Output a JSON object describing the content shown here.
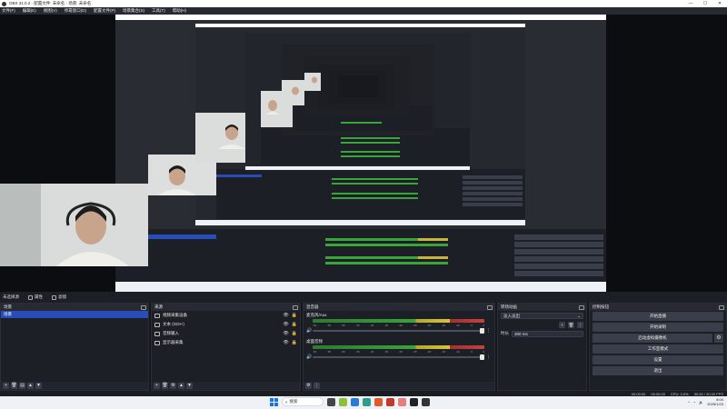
{
  "window": {
    "title": "OBS 31.0.2 - 配置文件: 未命名 - 场景: 未命名",
    "controls": [
      "—",
      "☐",
      "✕"
    ]
  },
  "menubar": [
    "文件(F)",
    "编辑(E)",
    "视图(V)",
    "停靠窗口(D)",
    "配置文件(P)",
    "场景集合(S)",
    "工具(T)",
    "帮助(H)"
  ],
  "sceneinfo": {
    "label": "未选择源",
    "props_btn": "属性",
    "filters_btn": "滤镜"
  },
  "docks": {
    "scenes": {
      "title": "场景",
      "items": [
        {
          "label": "场景",
          "selected": true
        }
      ]
    },
    "sources": {
      "title": "来源",
      "items": [
        {
          "name": "视频采集设备",
          "icon": "camera-icon"
        },
        {
          "name": "文本 (GDI+)",
          "icon": "text-icon"
        },
        {
          "name": "音频输入",
          "icon": "mic-icon"
        },
        {
          "name": "显示器采集",
          "icon": "monitor-icon"
        }
      ]
    },
    "mixer": {
      "title": "混音器",
      "scale": [
        "-60",
        "-55",
        "-50",
        "-45",
        "-40",
        "-35",
        "-30",
        "-25",
        "-20",
        "-15",
        "-10",
        "-5",
        "0"
      ],
      "tracks": [
        {
          "name": "麦克风/Aux",
          "level": 0.82
        },
        {
          "name": "桌面音频",
          "level": 0.82
        }
      ]
    },
    "transitions": {
      "title": "转场动画",
      "transition": "淡入淡出",
      "duration_label": "时长",
      "duration": "300 ms"
    },
    "controls": {
      "title": "控制按钮",
      "buttons": [
        "开始直播",
        "开始录制",
        "启动虚拟摄像机",
        "工作室模式",
        "设置",
        "退出"
      ]
    }
  },
  "statusbar": {
    "stream_time": "00:00:00",
    "rec_time": "00:00:00",
    "cpu": "CPU: 0.6%",
    "fps": "30.00 / 30.00 FPS"
  },
  "taskbar": {
    "search": "搜索",
    "time": "8:04",
    "date": "2025/1/23"
  },
  "colors": {
    "selected": "#284cb8",
    "panel": "#1d1f26",
    "header": "#272a33",
    "button": "#3a3e4a"
  }
}
